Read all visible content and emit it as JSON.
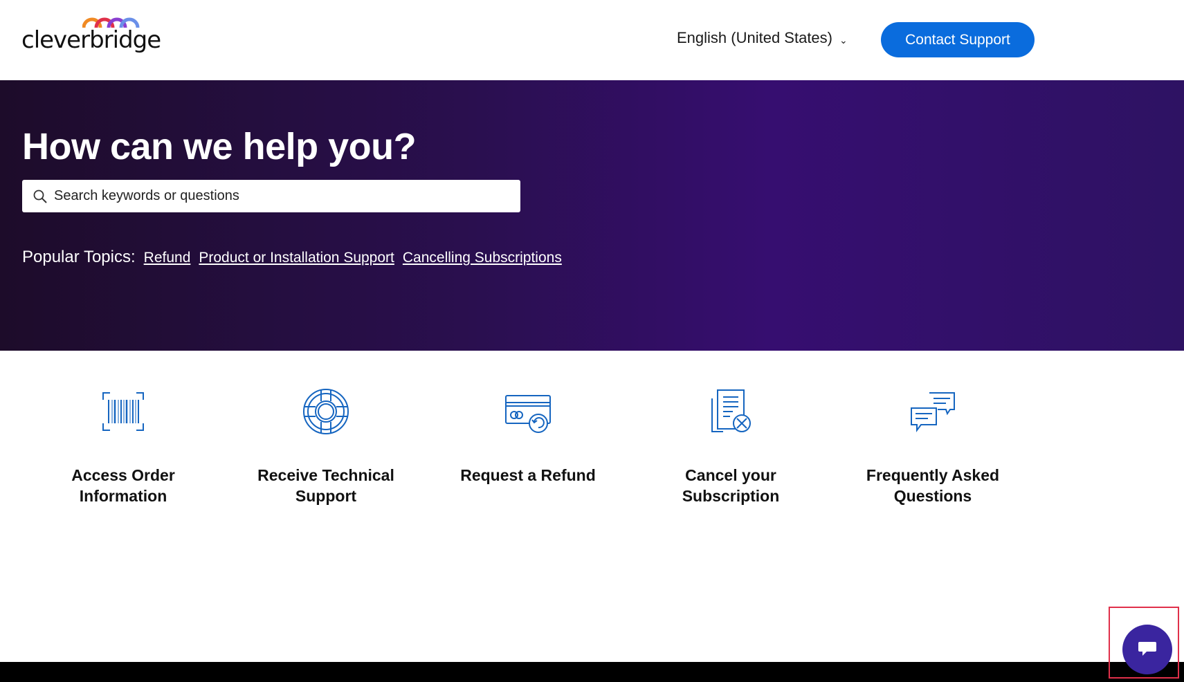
{
  "header": {
    "logo_text": "cleverbridge",
    "language_label": "English (United States)",
    "contact_button": "Contact Support"
  },
  "hero": {
    "title": "How can we help you?",
    "search_placeholder": "Search keywords or questions",
    "popular_label": "Popular Topics:",
    "popular_links": [
      "Refund",
      "Product or Installation Support",
      "Cancelling Subscriptions"
    ]
  },
  "cards": [
    {
      "label": "Access Order Information",
      "icon": "barcode-icon"
    },
    {
      "label": "Receive Technical Support",
      "icon": "lifebuoy-icon"
    },
    {
      "label": "Request a Refund",
      "icon": "credit-card-refund-icon"
    },
    {
      "label": "Cancel your Subscription",
      "icon": "document-cancel-icon"
    },
    {
      "label": "Frequently Asked Questions",
      "icon": "chat-bubbles-icon"
    }
  ],
  "colors": {
    "accent_blue": "#0a6cdd",
    "icon_blue": "#1565c0",
    "hero_dark": "#1d0c2a",
    "hero_purple": "#360e70",
    "chat_purple": "#3a259f"
  }
}
